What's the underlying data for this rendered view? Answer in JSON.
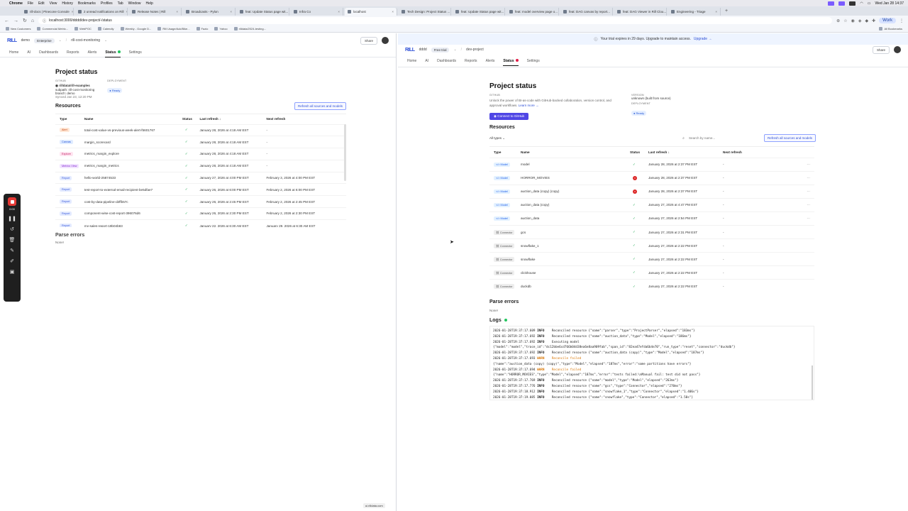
{
  "menubar": {
    "app": "Chrome",
    "menus": [
      "File",
      "Edit",
      "View",
      "History",
      "Bookmarks",
      "Profiles",
      "Tab",
      "Window",
      "Help"
    ],
    "clock": "Wed Jan 28  14:37"
  },
  "tabs": [
    {
      "label": "rill-docs | Pinecone Console"
    },
    {
      "label": "2 unread notifications on Rill"
    },
    {
      "label": "Release Notes | Rill"
    },
    {
      "label": "Broadcasts - Pylon"
    },
    {
      "label": "feat: Update Status page wit..."
    },
    {
      "label": "Infra Co"
    },
    {
      "label": "localhost",
      "active": true
    },
    {
      "label": "Tech Design: Project Status ..."
    },
    {
      "label": "feat: Update Status page wit..."
    },
    {
      "label": "feat: model overview page o..."
    },
    {
      "label": "feat: DAG canvas by report..."
    },
    {
      "label": "feat: DAG Viewer in Rill Clou..."
    },
    {
      "label": "Engineering - Triage"
    }
  ],
  "address": {
    "url": "localhost:3000/dddd/dev-project/-/status",
    "profile": "Work"
  },
  "bookmarks": [
    "New Customers",
    "Commercial Metric...",
    "WebPOC",
    "Calendly",
    "Weekly - Google D...",
    "Rill Usage/Ack/Bike...",
    "Fazio",
    "Yahoo",
    "rilldata/2024-testing...",
    "All Bookmarks"
  ],
  "left": {
    "org": "demo",
    "org_badge": "Enterprise",
    "project": "rill-cost-monitoring",
    "share": "Share",
    "tabs": [
      "Home",
      "AI",
      "Dashboards",
      "Reports",
      "Alerts",
      "Status",
      "Settings"
    ],
    "title": "Project status",
    "github_label": "GITHUB",
    "repo": "rilldata/rill-examples",
    "subpath": "subpath: rill-cost-monitoring",
    "branch": "branch: demo",
    "synced": "Synced Jan 23, 12:20 PM",
    "deployment_label": "DEPLOYMENT",
    "ready": "Ready",
    "resources_title": "Resources",
    "refresh_btn": "Refresh all sources and models",
    "columns": [
      "Type",
      "Name",
      "Status",
      "Last refresh ↓",
      "Next refresh"
    ],
    "rows": [
      {
        "type": "Alert",
        "cls": "t-alert",
        "name": "total-cost-value-vs-previous-week-alert-f5601767",
        "last": "January 28, 2026 at 4:18 AM EST",
        "next": "-"
      },
      {
        "type": "Canvas",
        "cls": "t-canvas",
        "name": "margin_scorecard",
        "last": "January 28, 2026 at 4:18 AM EST",
        "next": "-"
      },
      {
        "type": "Explore",
        "cls": "t-explore",
        "name": "metrics_margin_explore",
        "last": "January 28, 2026 at 4:18 AM EST",
        "next": "-"
      },
      {
        "type": "Metrics View",
        "cls": "t-mv",
        "name": "metrics_margin_metrics",
        "last": "January 28, 2026 at 4:18 AM EST",
        "next": "-"
      },
      {
        "type": "Report",
        "cls": "t-report",
        "name": "hello-world-25874533",
        "last": "January 27, 2026 at 4:00 PM EST",
        "next": "February 3, 2026 at 4:00 PM EST"
      },
      {
        "type": "Report",
        "cls": "t-report",
        "name": "test-report-to-external-email-recipient-be5dfae7",
        "last": "January 26, 2026 at 6:00 PM EST",
        "next": "February 2, 2026 at 6:00 PM EST"
      },
      {
        "type": "Report",
        "cls": "t-report",
        "name": "cost-by-data-pipeline-d2ffb57c",
        "last": "January 26, 2026 at 2:45 PM EST",
        "next": "February 2, 2026 at 2:45 PM EST"
      },
      {
        "type": "Report",
        "cls": "t-report",
        "name": "component-wise-cost-report-396076d6",
        "last": "January 26, 2026 at 2:30 PM EST",
        "next": "February 2, 2026 at 2:30 PM EST"
      },
      {
        "type": "Report",
        "cls": "t-report",
        "name": "my-sales-report-19b04b83",
        "last": "January 22, 2026 at 6:30 AM EST",
        "next": "January 29, 2026 at 6:30 AM EST"
      }
    ],
    "parse_title": "Parse errors",
    "parse_none": "None!"
  },
  "recorder": {
    "time": "0:00"
  },
  "right": {
    "banner_text": "Your trial expires in 29 days. Upgrade to maintain access.",
    "banner_link": "Upgrade →",
    "org": "dddd",
    "org_badge": "Free trial",
    "project": "dev-project",
    "share": "Share",
    "tabs": [
      "Home",
      "AI",
      "Dashboards",
      "Reports",
      "Alerts",
      "Status",
      "Settings"
    ],
    "title": "Project status",
    "github_label": "GITHUB",
    "github_desc": "Unlock the power of BI-as-code with GitHub-backed collaboration, version control, and approval workflows.",
    "learn_more": "Learn more →",
    "connect_btn": "Connect to GitHub",
    "version_label": "VERSION",
    "version": "unknown (built from source)",
    "deployment_label": "DEPLOYMENT",
    "ready": "Ready",
    "resources_title": "Resources",
    "filter": "All types",
    "search_placeholder": "Search by name...",
    "refresh_btn": "Refresh all sources and models",
    "columns": [
      "Type",
      "Name",
      "Status",
      "Last refresh ↓",
      "Next refresh"
    ],
    "rows": [
      {
        "type": "Model",
        "cls": "t-model",
        "name": "model",
        "status": "ok",
        "last": "January 28, 2026 at 2:37 PM EST",
        "next": "-",
        "menu": true
      },
      {
        "type": "Model",
        "cls": "t-model",
        "name": "HORROR_MOVIES",
        "status": "err",
        "last": "January 28, 2026 at 2:37 PM EST",
        "next": "-",
        "menu": true
      },
      {
        "type": "Model",
        "cls": "t-model",
        "name": "auction_data (copy) (copy)",
        "status": "err",
        "last": "January 28, 2026 at 2:37 PM EST",
        "next": "-",
        "menu": true
      },
      {
        "type": "Model",
        "cls": "t-model",
        "name": "auction_data (copy)",
        "status": "ok",
        "last": "January 27, 2026 at 4:47 PM EST",
        "next": "-",
        "menu": true
      },
      {
        "type": "Model",
        "cls": "t-model",
        "name": "auction_data",
        "status": "ok",
        "last": "January 27, 2026 at 2:54 PM EST",
        "next": "-",
        "menu": true
      },
      {
        "type": "Connector",
        "cls": "t-conn",
        "name": "gcs",
        "status": "ok",
        "last": "January 27, 2026 at 2:31 PM EST",
        "next": "-",
        "menu": false
      },
      {
        "type": "Connector",
        "cls": "t-conn",
        "name": "snowflake_1",
        "status": "ok",
        "last": "January 27, 2026 at 2:22 PM EST",
        "next": "-",
        "menu": false
      },
      {
        "type": "Connector",
        "cls": "t-conn",
        "name": "snowflake",
        "status": "ok",
        "last": "January 27, 2026 at 2:22 PM EST",
        "next": "-",
        "menu": false
      },
      {
        "type": "Connector",
        "cls": "t-conn",
        "name": "clickhouse",
        "status": "ok",
        "last": "January 27, 2026 at 2:22 PM EST",
        "next": "-",
        "menu": false
      },
      {
        "type": "Connector",
        "cls": "t-conn",
        "name": "duckdb",
        "status": "ok",
        "last": "January 27, 2026 at 2:22 PM EST",
        "next": "-",
        "menu": false
      }
    ],
    "parse_title": "Parse errors",
    "parse_none": "None!",
    "logs_title": "Logs",
    "logs": [
      {
        "ts": "2026-01-28T19:37:17.609",
        "lvl": "INFO",
        "msg": "Reconciled resource {\"name\":\"parser\",\"type\":\"ProjectParser\",\"elapsed\":\"183ms\"}"
      },
      {
        "ts": "2026-01-28T19:37:17.692",
        "lvl": "INFO",
        "msg": "Reconciled resource {\"name\":\"auction_data\",\"type\":\"Model\",\"elapsed\":\"186ms\"}"
      },
      {
        "ts": "2026-01-28T19:37:17.692",
        "lvl": "INFO",
        "msg": "Executing model"
      },
      {
        "ts": "",
        "lvl": "",
        "msg": "{\"model\":\"model\",\"trace_id\":\"dc12bbe6cd766b04d38ea6e8aa909fab\",\"span_id\":\"82ea47efda6b4e70\",\"run_type\":\"reset\",\"connector\":\"duckdb\"}"
      },
      {
        "ts": "2026-01-28T19:37:17.692",
        "lvl": "INFO",
        "msg": "Reconciled resource {\"name\":\"auction_data (copy)\",\"type\":\"Model\",\"elapsed\":\"187ms\"}"
      },
      {
        "ts": "2026-01-28T19:37:17.693",
        "lvl": "WARN",
        "msg": "Reconcile failed"
      },
      {
        "ts": "",
        "lvl": "",
        "msg": "{\"name\":\"auction_data (copy) (copy)\",\"type\":\"Model\",\"elapsed\":\"187ms\",\"error\":\"some partitions have errors\"}"
      },
      {
        "ts": "2026-01-28T19:37:17.694",
        "lvl": "WARN",
        "msg": "Reconcile failed"
      },
      {
        "ts": "",
        "lvl": "",
        "msg": "{\"name\":\"HORROR_MOVIES\",\"type\":\"Model\",\"elapsed\":\"187ms\",\"error\":\"tests failed:\\nManual fail: test did not pass\"}"
      },
      {
        "ts": "2026-01-28T19:37:17.769",
        "lvl": "INFO",
        "msg": "Reconciled resource {\"name\":\"model\",\"type\":\"Model\",\"elapsed\":\"263ms\"}"
      },
      {
        "ts": "2026-01-28T19:37:17.776",
        "lvl": "INFO",
        "msg": "Reconciled resource {\"name\":\"gcs\",\"type\":\"Connector\",\"elapsed\":\"270ms\"}"
      },
      {
        "ts": "2026-01-28T19:37:18.912",
        "lvl": "INFO",
        "msg": "Reconciled resource {\"name\":\"snowflake_1\",\"type\":\"Connector\",\"elapsed\":\"1.406s\"}"
      },
      {
        "ts": "2026-01-28T19:37:19.085",
        "lvl": "INFO",
        "msg": "Reconciled resource {\"name\":\"snowflake\",\"type\":\"Connector\",\"elapsed\":\"1.58s\"}"
      }
    ],
    "footer_url": "ui.rilldata.com"
  }
}
